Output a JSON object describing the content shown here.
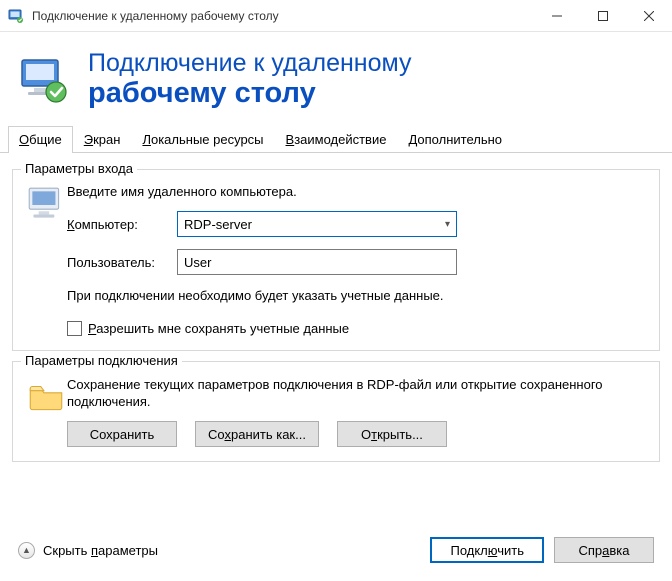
{
  "window": {
    "title": "Подключение к удаленному рабочему столу"
  },
  "banner": {
    "line1": "Подключение к удаленному",
    "line2": "рабочему столу"
  },
  "tabs": {
    "items": [
      {
        "label_pre": "",
        "hotkey": "О",
        "label_post": "бщие"
      },
      {
        "label_pre": "",
        "hotkey": "Э",
        "label_post": "кран"
      },
      {
        "label_pre": "",
        "hotkey": "Л",
        "label_post": "окальные ресурсы"
      },
      {
        "label_pre": "",
        "hotkey": "В",
        "label_post": "заимодействие"
      },
      {
        "label_pre": "",
        "hotkey": "Д",
        "label_post": "ополнительно"
      }
    ],
    "active_index": 0
  },
  "login_group": {
    "legend": "Параметры входа",
    "intro": "Введите имя удаленного компьютера.",
    "computer_label_pre": "",
    "computer_label_hot": "К",
    "computer_label_post": "омпьютер:",
    "computer_value": "RDP-server",
    "user_label": "Пользователь:",
    "user_value": "User",
    "note": "При подключении необходимо будет указать учетные данные.",
    "checkbox_pre": "",
    "checkbox_hot": "Р",
    "checkbox_post": "азрешить мне сохранять учетные данные",
    "checkbox_checked": false
  },
  "conn_group": {
    "legend": "Параметры подключения",
    "desc": "Сохранение текущих параметров подключения в RDP-файл или открытие сохраненного подключения.",
    "save_label": "Сохранить",
    "saveas_pre": "Со",
    "saveas_hot": "х",
    "saveas_post": "ранить как...",
    "open_pre": "О",
    "open_hot": "т",
    "open_post": "крыть..."
  },
  "footer": {
    "collapse_pre": "Скрыть ",
    "collapse_hot": "п",
    "collapse_post": "араметры",
    "connect_pre": "Подкл",
    "connect_hot": "ю",
    "connect_post": "чить",
    "help_pre": "Спр",
    "help_hot": "а",
    "help_post": "вка"
  }
}
